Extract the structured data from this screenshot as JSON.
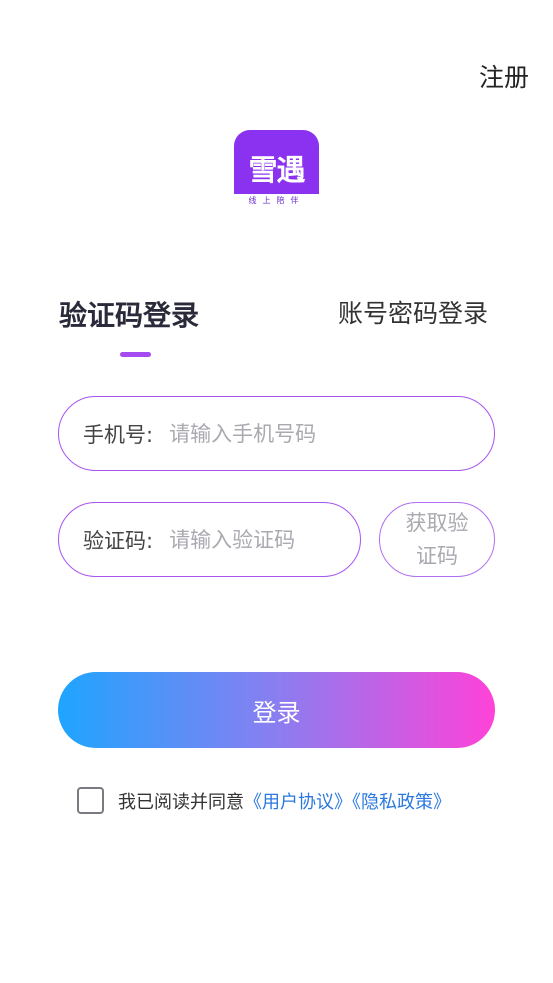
{
  "header": {
    "register_label": "注册"
  },
  "logo": {
    "text": "雪遇",
    "tagline": "线上陪伴"
  },
  "tabs": [
    {
      "label": "验证码登录",
      "active": true
    },
    {
      "label": "账号密码登录",
      "active": false
    }
  ],
  "form": {
    "phone": {
      "label": "手机号:",
      "placeholder": "请输入手机号码",
      "value": ""
    },
    "code": {
      "label": "验证码:",
      "placeholder": "请输入验证码",
      "value": ""
    },
    "get_code_label": "获取验证码",
    "login_label": "登录"
  },
  "agreement": {
    "checked": false,
    "prefix": "我已阅读并同意",
    "user_agreement": "《用户协议》",
    "privacy_policy": "《隐私政策》"
  },
  "colors": {
    "accent_purple": "#a855f0",
    "logo_purple": "#8a32f0",
    "link_blue": "#2a78e0",
    "gradient_start": "#1ea5ff",
    "gradient_end": "#ff42d8"
  }
}
